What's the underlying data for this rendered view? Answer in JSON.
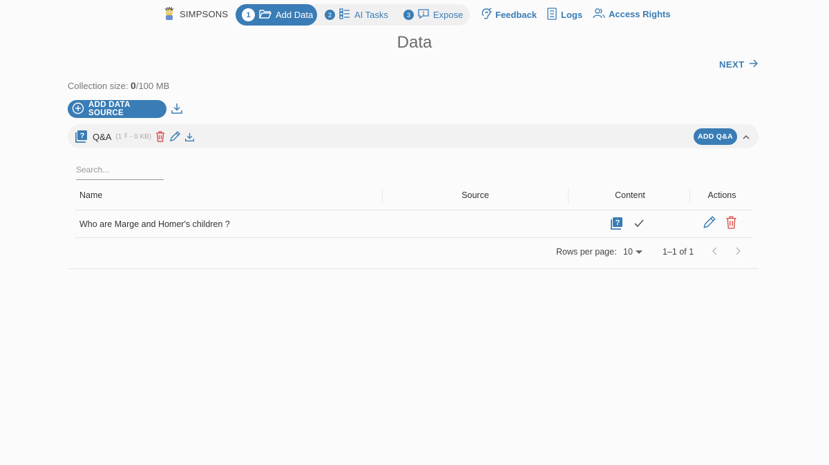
{
  "nav": {
    "brand": "SIMPSONS",
    "steps": [
      {
        "num": "1",
        "label": "Add Data",
        "icon": "folder-open-icon"
      },
      {
        "num": "2",
        "label": "AI Tasks",
        "icon": "list-tasks-icon"
      },
      {
        "num": "3",
        "label": "Expose",
        "icon": "chat-bubble-icon"
      }
    ],
    "links": [
      {
        "label": "Feedback",
        "icon": "feedback-ear-icon"
      },
      {
        "label": "Logs",
        "icon": "notebook-icon"
      },
      {
        "label": "Access Rights",
        "icon": "users-icon"
      }
    ]
  },
  "page": {
    "title": "Data",
    "next": "NEXT",
    "collection_label": "Collection size: ",
    "collection_used": "0",
    "collection_total": "/100 MB",
    "add_source": "ADD DATA SOURCE"
  },
  "source": {
    "name": "Q&A",
    "meta": "(1 ",
    "meta_size": " - 0 KB)",
    "add_button": "ADD Q&A"
  },
  "table": {
    "search_placeholder": "Search...",
    "columns": [
      "Name",
      "Source",
      "Content",
      "Actions"
    ],
    "rows": [
      {
        "name": "Who are Marge and Homer's children ?",
        "source": ""
      }
    ]
  },
  "pagination": {
    "rows_label": "Rows per page:",
    "rows_value": "10",
    "range": "1–1 of 1"
  },
  "colors": {
    "accent": "#3a7cb5",
    "danger": "#d9534f"
  }
}
